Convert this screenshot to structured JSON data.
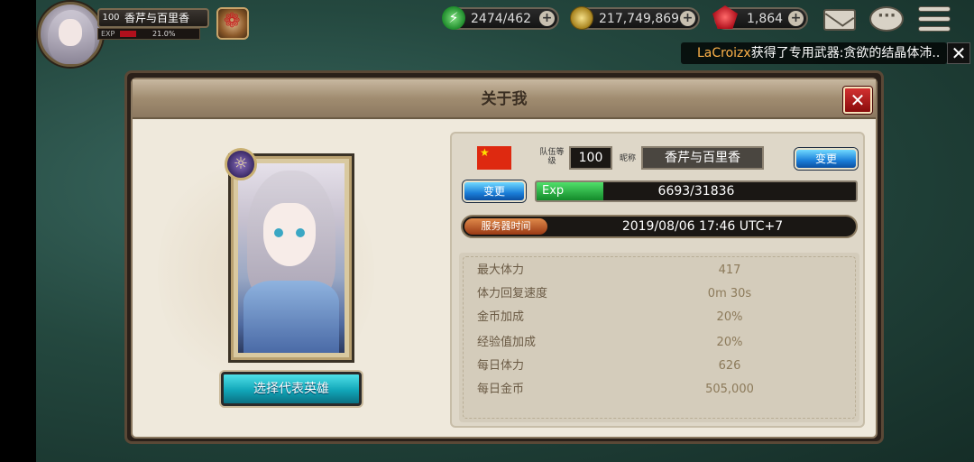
{
  "hud": {
    "player_level": "100",
    "player_name": "香芹与百里香",
    "exp_label": "EXP",
    "exp_percent_text": "21.0%",
    "exp_fraction": 0.21,
    "stamina": "2474/462",
    "gold": "217,749,869",
    "rubies": "1,864",
    "plus": "+"
  },
  "ticker": {
    "name": "LaCroizx",
    "message": "获得了专用武器:贪欲的结晶体沛..",
    "close": "✕"
  },
  "dialog": {
    "title": "关于我",
    "pick_hero_label": "选择代表英雄",
    "team_level_label": "队伍等级",
    "team_level": "100",
    "nickname_label": "昵称",
    "nickname": "香芹与百里香",
    "change_label": "变更",
    "exp_label": "Exp",
    "exp_value": "6693/31836",
    "exp_fraction": 0.21,
    "server_time_label": "服务器时间",
    "server_time": "2019/08/06 17:46 UTC+7",
    "stats": [
      {
        "label": "最大体力",
        "value": "417"
      },
      {
        "label": "体力回复速度",
        "value": "0m 30s"
      },
      {
        "label": "金币加成",
        "value": "20%"
      },
      {
        "label": "经验值加成",
        "value": "20%"
      },
      {
        "label": "每日体力",
        "value": "626"
      },
      {
        "label": "每日金币",
        "value": "505,000"
      }
    ]
  },
  "colors": {
    "accent_cyan": "#11a6b8",
    "button_blue": "#1a7ed8",
    "close_red": "#d23030",
    "exp_green": "#4fe06a"
  }
}
